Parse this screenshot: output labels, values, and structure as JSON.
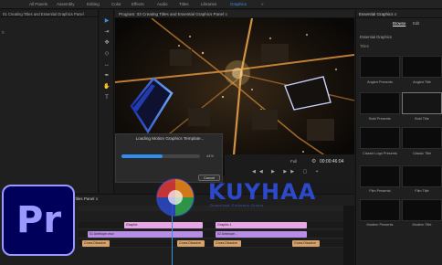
{
  "menu": {
    "items": [
      {
        "label": "All Panels",
        "active": false
      },
      {
        "label": "Assembly",
        "active": false
      },
      {
        "label": "Editing",
        "active": false
      },
      {
        "label": "Color",
        "active": false
      },
      {
        "label": "Effects",
        "active": false
      },
      {
        "label": "Audio",
        "active": false
      },
      {
        "label": "Titles",
        "active": false
      },
      {
        "label": "Libraries",
        "active": false
      },
      {
        "label": "Graphics",
        "active": true
      },
      {
        "label": "»",
        "active": false
      }
    ]
  },
  "left_panel": {
    "title": "01 Creating Titles and Essential Graphics Panel",
    "close": "≡",
    "content": "0"
  },
  "program": {
    "title": "Program: 03 Creating Titles and Essential Graphics Panel  ≡"
  },
  "dialog": {
    "title": "Loading Motion Graphics Template...",
    "progress": 0.52,
    "percent_label": "44%",
    "cancel_label": "Cancel"
  },
  "transport": {
    "fit_label": "Full",
    "timecode": "00:00:46:04"
  },
  "essential_graphics": {
    "title": "Essential Graphics  ≡",
    "tab_browse": "Browse",
    "tab_edit": "Edit",
    "section": "Essential Graphics",
    "filter": "Titles",
    "templates": [
      {
        "label": "Angled Presents",
        "selected": false
      },
      {
        "label": "Angled Title",
        "selected": false
      },
      {
        "label": "Bold Presents",
        "selected": false
      },
      {
        "label": "Bold Title",
        "selected": true
      },
      {
        "label": "Classic Logo Presents",
        "selected": false
      },
      {
        "label": "Classic Title",
        "selected": false
      },
      {
        "label": "Film Presents",
        "selected": false
      },
      {
        "label": "Film Title",
        "selected": false
      },
      {
        "label": "Modern Presents",
        "selected": false
      },
      {
        "label": "Modern Title",
        "selected": false
      }
    ]
  },
  "timeline": {
    "title": "Titles Panel  ≡",
    "clips": {
      "graphic_a": "Graphic",
      "graphic_b": "Graphic 1",
      "video_a": "01 Antelope.mov",
      "video_b": "02 Antelope...",
      "audio_a": "Cross Dissolve",
      "audio_b": "Cross Dissolve",
      "audio_c": "Cross Dissolve",
      "audio_d": "Cross Dissolve"
    }
  },
  "logo": {
    "text": "Pr"
  },
  "watermark": {
    "text": "KUYHAA",
    "sub": "Download Software Gratis"
  },
  "colors": {
    "accent": "#3d8fe0",
    "pink_clip": "#e7a6e6",
    "violet_clip": "#b88de5",
    "orange_clip": "#d7a16a",
    "pr_bg": "#00005b",
    "pr_fg": "#9999ff"
  }
}
